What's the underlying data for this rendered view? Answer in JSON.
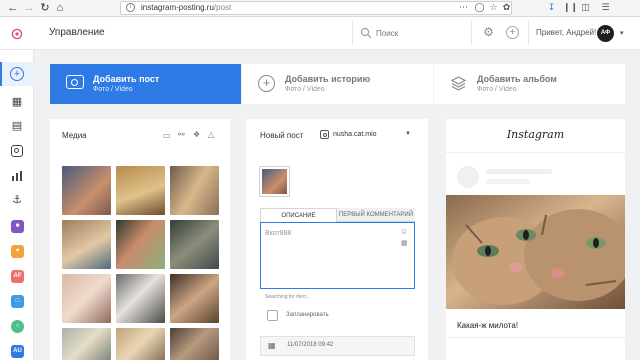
{
  "browser": {
    "url_host": "instagram-posting.ru",
    "url_path": "/post"
  },
  "header": {
    "title": "Управление",
    "search_placeholder": "Поиск",
    "greeting": "Привет, Андрей!",
    "avatar_initials": "АФ"
  },
  "sidebar": {
    "active_color": "#2f7be5",
    "apps": [
      "AF",
      "AU"
    ]
  },
  "actions": [
    {
      "title": "Добавить пост",
      "subtitle": "Фото / Video",
      "active": true
    },
    {
      "title": "Добавить историю",
      "subtitle": "Фото / Video",
      "active": false
    },
    {
      "title": "Добавить альбом",
      "subtitle": "Фото / Video",
      "active": false
    }
  ],
  "media": {
    "title": "Медиа"
  },
  "post": {
    "title": "Новый пост",
    "account": "nusha.cat.mio",
    "tabs": [
      "ОПИСАНИЕ",
      "ПЕРВЫЙ КОММЕНТАРИЙ"
    ],
    "caption_value": "Вкот888",
    "hashtag_hint": "Searching for #кот...",
    "schedule_label": "Запланировать",
    "date_value": "11/07/2018 09:42"
  },
  "preview": {
    "logo": "Instagram",
    "caption": "Какая-ж милота!"
  },
  "colors": {
    "accent": "#2f7be5",
    "tab_inactive": "#f0f1f3"
  }
}
